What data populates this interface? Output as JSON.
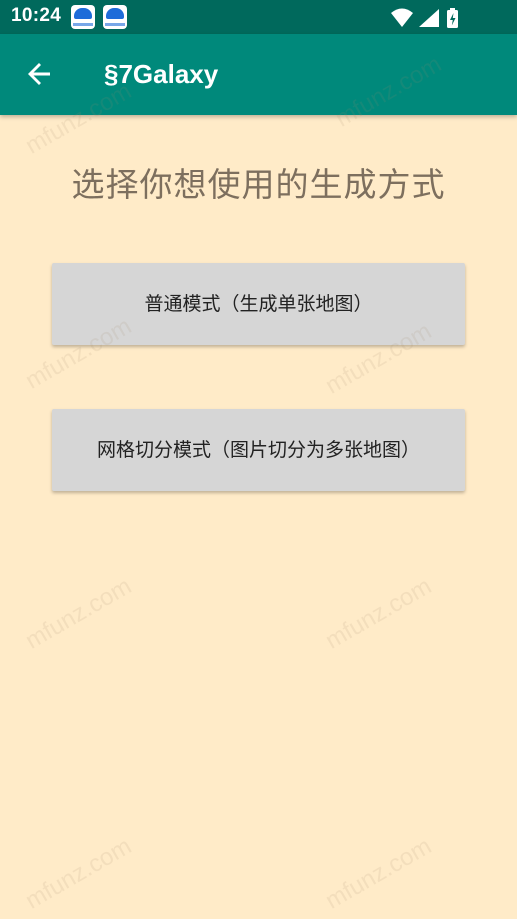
{
  "status_bar": {
    "time": "10:24",
    "notification_icons": [
      "app-notification-icon",
      "app-notification-icon"
    ],
    "indicators": [
      "wifi-icon",
      "signal-icon",
      "battery-charging-icon"
    ]
  },
  "app_bar": {
    "back_icon": "arrow-back-icon",
    "title": "§7Galaxy"
  },
  "main": {
    "prompt": "选择你想使用的生成方式",
    "buttons": [
      {
        "label": "普通模式（生成单张地图）"
      },
      {
        "label": "网格切分模式（图片切分为多张地图）"
      }
    ]
  },
  "watermark": "mfunz.com",
  "colors": {
    "status_bar": "#00695C",
    "app_bar": "#00897B",
    "background": "#FFEBC8",
    "button": "#D6D6D6",
    "prompt_text": "#7D6F5E"
  }
}
